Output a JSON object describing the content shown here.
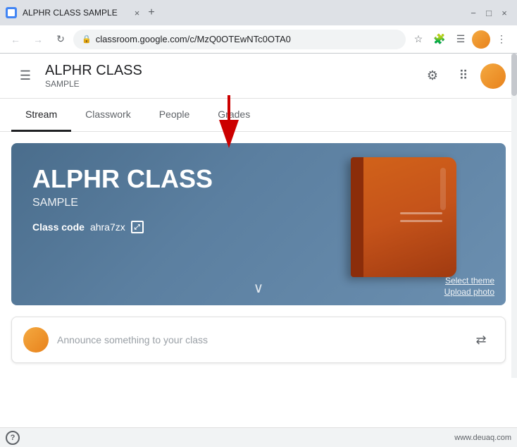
{
  "browser": {
    "tab_title": "ALPHR CLASS SAMPLE",
    "url": "classroom.google.com/c/MzQ0OTEwNTc0OTA0",
    "new_tab_icon": "+",
    "nav": {
      "back": "←",
      "forward": "→",
      "reload": "↻"
    },
    "window_controls": {
      "minimize": "−",
      "maximize": "□",
      "close": "×"
    }
  },
  "app": {
    "header": {
      "hamburger_label": "☰",
      "class_name": "ALPHR CLASS",
      "class_subtitle": "SAMPLE"
    },
    "tabs": [
      {
        "label": "Stream",
        "active": true
      },
      {
        "label": "Classwork",
        "active": false
      },
      {
        "label": "People",
        "active": false
      },
      {
        "label": "Grades",
        "active": false
      }
    ],
    "banner": {
      "class_name": "ALPHR CLASS",
      "subtitle": "SAMPLE",
      "class_code_label": "Class code",
      "class_code_value": "ahra7zx",
      "select_theme": "Select theme",
      "upload_photo": "Upload photo",
      "chevron": "∨"
    },
    "announce": {
      "placeholder": "Announce something to your class",
      "repost_icon": "⇄"
    }
  },
  "bottom": {
    "help_label": "?",
    "url": "www.deuaq.com"
  },
  "arrow": {
    "color": "#cc0000"
  }
}
